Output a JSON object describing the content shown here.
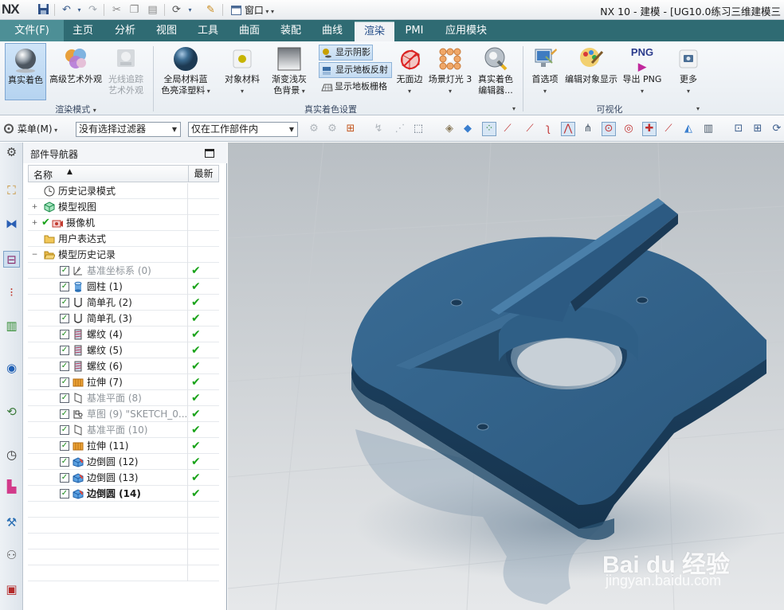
{
  "titlebar": {
    "logo": "NX",
    "window_menu": "窗口",
    "title": "NX 10 - 建模 - [UG10.0练习三维建模三"
  },
  "tabs": {
    "file": "文件(F)",
    "items": [
      "主页",
      "分析",
      "视图",
      "工具",
      "曲面",
      "装配",
      "曲线",
      "渲染",
      "PMI",
      "应用模块"
    ],
    "active": "渲染"
  },
  "ribbon": {
    "render_mode": {
      "group_label": "渲染模式",
      "true_shading": "真实着色",
      "advanced_studio": "高级艺术外观",
      "ray_traced_1": "光线追踪",
      "ray_traced_2": "艺术外观"
    },
    "shading_settings": {
      "group_label": "真实着色设置",
      "global_material_1": "全局材料蓝",
      "global_material_2": "色亮泽塑料",
      "object_material": "对象材料",
      "gradient_bg_1": "渐变浅灰",
      "gradient_bg_2": "色背景",
      "show_shadow": "显示阴影",
      "show_floor_reflection": "显示地板反射",
      "show_floor_grid": "显示地板栅格",
      "no_edges": "无面边",
      "scene_light": "场景灯光 3",
      "true_shading_editor_1": "真实着色",
      "true_shading_editor_2": "编辑器..."
    },
    "visualization": {
      "group_label": "可视化",
      "preferences": "首选项",
      "edit_object_display": "编辑对象显示",
      "png_label": "PNG",
      "export_png": "导出 PNG",
      "more": "更多"
    }
  },
  "toolbar": {
    "menu": "菜单(M)",
    "filter": "没有选择过滤器",
    "scope": "仅在工作部件内"
  },
  "navigator": {
    "title": "部件导航器",
    "col_name": "名称",
    "col_latest": "最新",
    "items": [
      {
        "label": "历史记录模式",
        "icon": "clock-icon"
      },
      {
        "label": "模型视图",
        "icon": "model-view-icon"
      },
      {
        "label": "摄像机",
        "icon": "camera-icon"
      },
      {
        "label": "用户表达式",
        "icon": "folder-icon"
      },
      {
        "label": "模型历史记录",
        "icon": "folder-open-icon"
      },
      {
        "label": "基准坐标系 (0)",
        "icon": "datum-csys-icon"
      },
      {
        "label": "圆柱 (1)",
        "icon": "cylinder-icon"
      },
      {
        "label": "简单孔 (2)",
        "icon": "hole-icon"
      },
      {
        "label": "简单孔 (3)",
        "icon": "hole-icon"
      },
      {
        "label": "螺纹 (4)",
        "icon": "thread-icon"
      },
      {
        "label": "螺纹 (5)",
        "icon": "thread-icon"
      },
      {
        "label": "螺纹 (6)",
        "icon": "thread-icon"
      },
      {
        "label": "拉伸 (7)",
        "icon": "extrude-icon"
      },
      {
        "label": "基准平面 (8)",
        "icon": "datum-plane-icon"
      },
      {
        "label": "草图 (9) \"SKETCH_0...",
        "icon": "sketch-icon"
      },
      {
        "label": "基准平面 (10)",
        "icon": "datum-plane-icon"
      },
      {
        "label": "拉伸 (11)",
        "icon": "extrude-icon"
      },
      {
        "label": "边倒圆 (12)",
        "icon": "edge-blend-icon"
      },
      {
        "label": "边倒圆 (13)",
        "icon": "edge-blend-icon"
      },
      {
        "label": "边倒圆 (14)",
        "icon": "edge-blend-icon"
      }
    ]
  },
  "watermark": {
    "brand": "Bai du 经验",
    "url": "jingyan.baidu.com"
  },
  "colors": {
    "model_blue": "#2e5f87",
    "tab_bar": "#2f6b73",
    "check_green": "#1aa31a"
  }
}
